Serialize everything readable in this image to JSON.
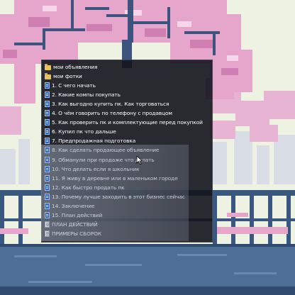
{
  "desktop": {
    "wallpaper": "pixel-art-sakura-city",
    "colors": {
      "sky": "#eef2e2",
      "blossom": "#e6a6cc",
      "blossom_dark": "#d07fb2",
      "trunk": "#3d557e",
      "railing": "#3a587f",
      "water": "#4d6f96"
    }
  },
  "file_list": {
    "items": [
      {
        "type": "folder",
        "icon": "folder-icon",
        "label": "мои объявления"
      },
      {
        "type": "folder",
        "icon": "folder-icon",
        "label": "мои фотки"
      },
      {
        "type": "doc",
        "icon": "word-doc-icon",
        "label": "1. С чего начать"
      },
      {
        "type": "doc",
        "icon": "word-doc-icon",
        "label": "2. Какие компы покупать"
      },
      {
        "type": "doc",
        "icon": "word-doc-icon",
        "label": "3. Как выгодно купить пк. Как торговаться"
      },
      {
        "type": "doc",
        "icon": "word-doc-icon",
        "label": "4. О чём говорить по телефону с продавцом"
      },
      {
        "type": "doc",
        "icon": "word-doc-icon",
        "label": "5. Как проверить пк и комплектующие перед покупкой"
      },
      {
        "type": "doc",
        "icon": "word-doc-icon",
        "label": "6. Купил пк что дальше"
      },
      {
        "type": "doc",
        "icon": "word-doc-icon",
        "label": "7. Предпродажная подготовка"
      },
      {
        "type": "doc",
        "icon": "word-doc-icon",
        "label": "8. Как сделать продающее объявление"
      },
      {
        "type": "doc",
        "icon": "word-doc-icon",
        "label": "9. Обманули при продаже что делать"
      },
      {
        "type": "doc",
        "icon": "word-doc-icon",
        "label": "10. Что делать если я школьник"
      },
      {
        "type": "doc",
        "icon": "word-doc-icon",
        "label": "11. Я живу в деревне или в маленьком городе"
      },
      {
        "type": "doc",
        "icon": "word-doc-icon",
        "label": "12. Как быстро продать пк"
      },
      {
        "type": "doc",
        "icon": "word-doc-icon",
        "label": "13. Почему лучше заходить в этот бизнес сейчас"
      },
      {
        "type": "doc",
        "icon": "word-doc-icon",
        "label": "14. Заключение"
      },
      {
        "type": "doc",
        "icon": "word-doc-icon",
        "label": "15. План действий"
      },
      {
        "type": "sheet",
        "icon": "document-icon",
        "label": "ПЛАН ДЕЙСТВИЙ"
      },
      {
        "type": "sheet",
        "icon": "document-icon",
        "label": "ПРИМЕРЫ СБОРОК"
      }
    ]
  }
}
